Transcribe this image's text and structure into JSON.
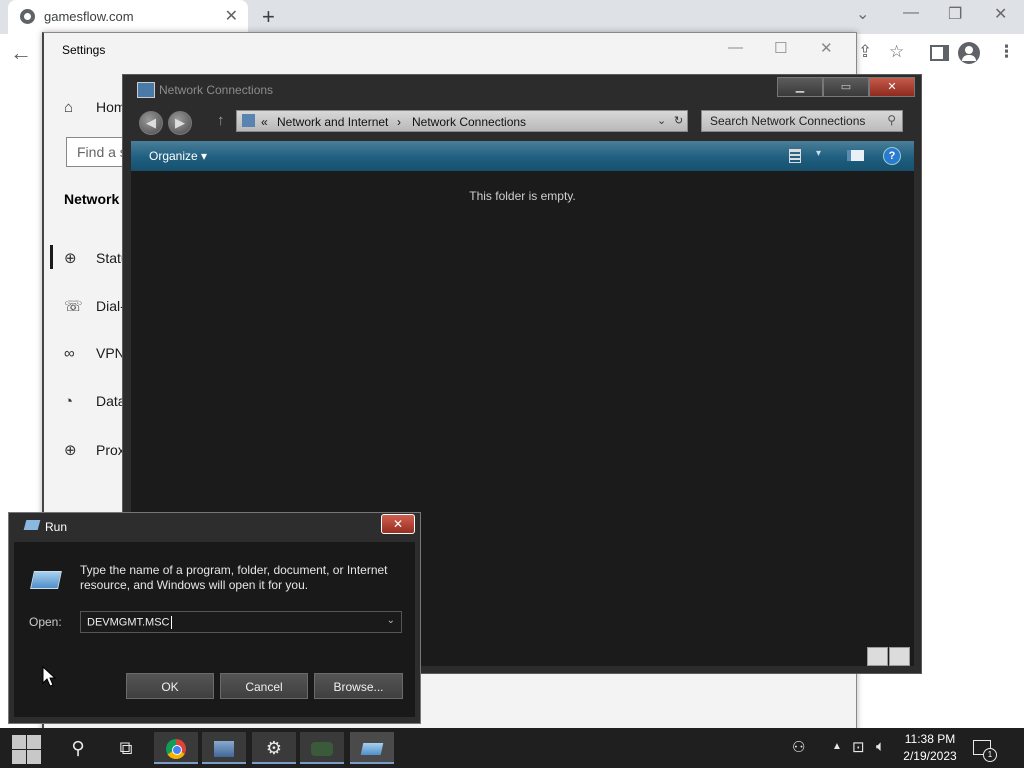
{
  "browser": {
    "tab_title": "gamesflow.com",
    "new_tab_glyph": "+",
    "tab_close_glyph": "✕",
    "window_controls": {
      "dropdown": "⌄",
      "minimize": "—",
      "restore": "❐",
      "close": "✕"
    },
    "back_glyph": "←",
    "toolbar_icons": {
      "share": "⇪",
      "bookmark": "☆",
      "menu": "⋮"
    }
  },
  "settings": {
    "title": "Settings",
    "controls": {
      "minimize": "—",
      "maximize": "☐",
      "close": "✕"
    },
    "home_label": "Hom",
    "search_placeholder": "Find a s",
    "section_title": "Network",
    "nav_items": [
      {
        "label": "Statu",
        "icon": "globe-icon",
        "glyph": "⊕"
      },
      {
        "label": "Dial-",
        "icon": "dialup-icon",
        "glyph": "☏"
      },
      {
        "label": "VPN",
        "icon": "vpn-icon",
        "glyph": "∞"
      },
      {
        "label": "Data",
        "icon": "data-usage-icon",
        "glyph": "◔"
      },
      {
        "label": "Prox",
        "icon": "proxy-icon",
        "glyph": "⊕"
      }
    ]
  },
  "network_connections": {
    "title": "Network Connections",
    "breadcrumb": [
      "«",
      "Network and Internet",
      "Network Connections"
    ],
    "search_placeholder": "Search Network Connections",
    "organize_label": "Organize ▾",
    "empty_message": "This folder is empty.",
    "controls": {
      "minimize": "▁",
      "maximize": "▭",
      "close": "✕"
    }
  },
  "run_dialog": {
    "title": "Run",
    "description": "Type the name of a program, folder, document, or Internet resource, and Windows will open it for you.",
    "open_label": "Open:",
    "command_value": "DEVMGMT.MSC",
    "buttons": {
      "ok": "OK",
      "cancel": "Cancel",
      "browse": "Browse..."
    },
    "close_glyph": "✕"
  },
  "taskbar": {
    "time": "11:38 PM",
    "date": "2/19/2023",
    "notification_count": "1",
    "search_glyph": "⚲",
    "task_view_glyph": "⧉",
    "settings_glyph": "⚙",
    "people_glyph": "⚇",
    "tray_up_glyph": "▲",
    "network_glyph": "⊡",
    "volume_glyph": "🔈︎"
  }
}
